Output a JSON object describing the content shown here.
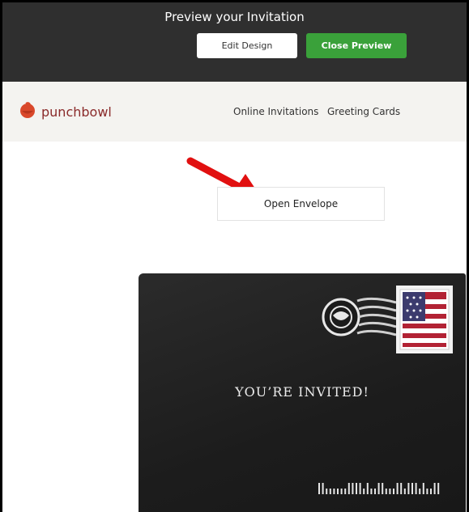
{
  "preview_bar": {
    "title": "Preview your Invitation",
    "edit_label": "Edit Design",
    "close_label": "Close Preview",
    "close_color": "#3aa13a",
    "background_color": "#2f2f2f"
  },
  "site_header": {
    "logo_text": "punchbowl",
    "logo_icon": "punchbowl-logo-icon",
    "nav": [
      {
        "label": "Online Invitations"
      },
      {
        "label": "Greeting Cards"
      }
    ]
  },
  "main": {
    "open_envelope_label": "Open Envelope",
    "annotation_icon": "red-arrow-icon",
    "envelope": {
      "text": "YOU’RE INVITED!",
      "stamp_icon": "us-flag-stamp-icon",
      "postmark_icon": "postmark-icon",
      "barcode_icon": "postal-barcode-icon"
    }
  }
}
